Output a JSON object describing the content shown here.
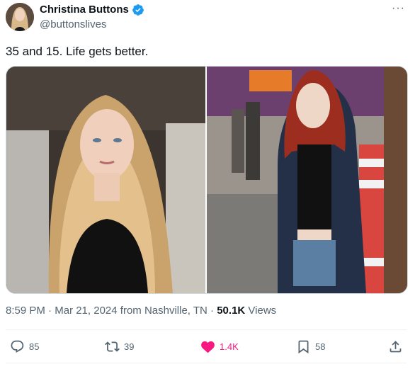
{
  "author": {
    "name": "Christina Buttons",
    "handle": "@buttonslives",
    "verified": true
  },
  "tweet": {
    "text": "35 and 15. Life gets better.",
    "media": [
      {
        "alt": "Woman with long blonde hair in black top"
      },
      {
        "alt": "Teen with red hair in dark hoodie at fair"
      }
    ]
  },
  "meta": {
    "time": "8:59 PM",
    "date": "Mar 21, 2024",
    "location_prefix": "from",
    "location": "Nashville, TN",
    "views_count": "50.1K",
    "views_label": "Views",
    "separator": "·"
  },
  "actions": {
    "replies": "85",
    "reposts": "39",
    "likes": "1.4K",
    "bookmarks": "58"
  },
  "colors": {
    "verified": "#1d9bf0",
    "like": "#f91880",
    "muted": "#536471"
  },
  "icons": [
    "verified-badge-icon",
    "more-icon",
    "reply-icon",
    "repost-icon",
    "like-icon",
    "bookmark-icon",
    "share-icon"
  ]
}
